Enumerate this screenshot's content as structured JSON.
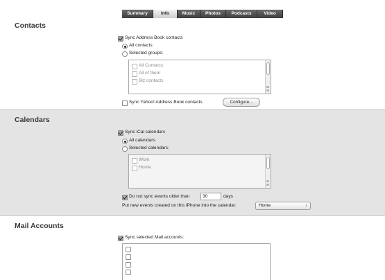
{
  "tabs": [
    "Summary",
    "Info",
    "Music",
    "Photos",
    "Podcasts",
    "Video"
  ],
  "active_tab": "Info",
  "contacts": {
    "title": "Contacts",
    "sync_label": "Sync Address Book contacts",
    "sync_checked": true,
    "all_label": "All contacts",
    "selected_label": "Selected groups:",
    "groups": [
      "All Contacts",
      "All of them",
      "Biz contacts"
    ],
    "yahoo_label": "Sync Yahoo! Address Book contacts",
    "configure_label": "Configure..."
  },
  "calendars": {
    "title": "Calendars",
    "sync_label": "Sync iCal calendars",
    "sync_checked": true,
    "all_label": "All calendars",
    "selected_label": "Selected calendars:",
    "calendars": [
      "Work",
      "Home"
    ],
    "older_label": "Do not sync events older than",
    "older_value": "30",
    "days_label": "days",
    "put_label": "Put new events created on this iPhone into the calendar:",
    "put_value": "Home"
  },
  "mail": {
    "title": "Mail Accounts",
    "sync_label": "Sync selected Mail accounts:",
    "sync_checked": true
  },
  "icons": {
    "checkbox": "checkbox-icon",
    "radio": "radio-icon",
    "popup_arrow": "updown-arrows-icon"
  }
}
